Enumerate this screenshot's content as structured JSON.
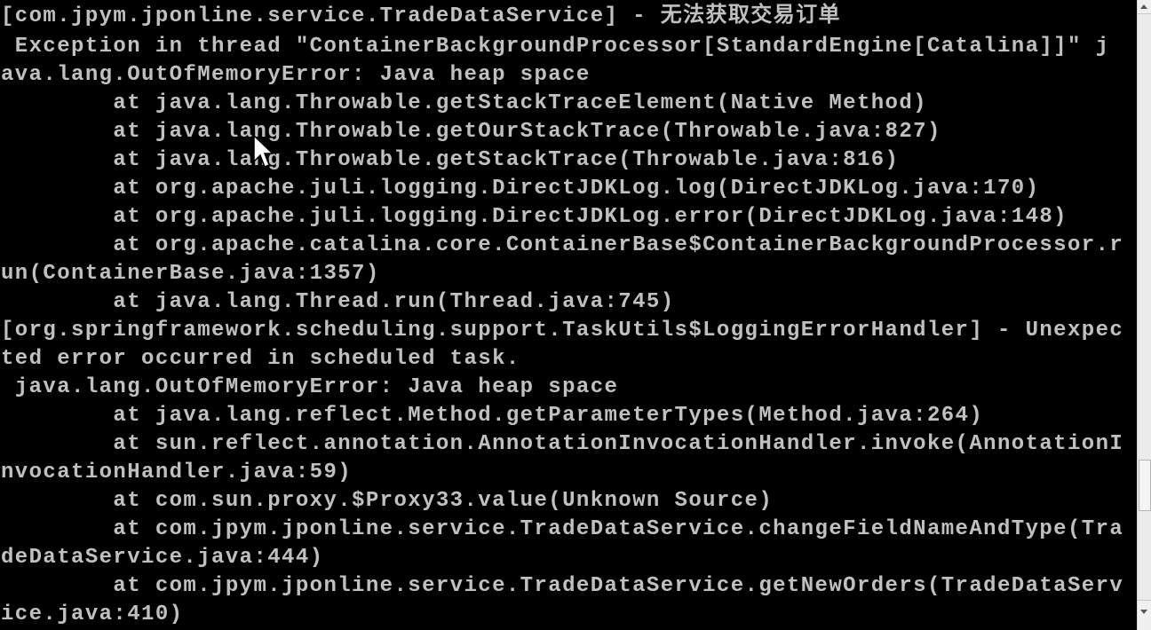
{
  "console": {
    "lines": [
      "[com.jpym.jponline.service.TradeDataService] - 无法获取交易订单",
      " Exception in thread \"ContainerBackgroundProcessor[StandardEngine[Catalina]]\" j",
      "ava.lang.OutOfMemoryError: Java heap space",
      "        at java.lang.Throwable.getStackTraceElement(Native Method)",
      "        at java.lang.Throwable.getOurStackTrace(Throwable.java:827)",
      "        at java.lang.Throwable.getStackTrace(Throwable.java:816)",
      "        at org.apache.juli.logging.DirectJDKLog.log(DirectJDKLog.java:170)",
      "        at org.apache.juli.logging.DirectJDKLog.error(DirectJDKLog.java:148)",
      "        at org.apache.catalina.core.ContainerBase$ContainerBackgroundProcessor.r",
      "un(ContainerBase.java:1357)",
      "        at java.lang.Thread.run(Thread.java:745)",
      "[org.springframework.scheduling.support.TaskUtils$LoggingErrorHandler] - Unexpec",
      "ted error occurred in scheduled task.",
      " java.lang.OutOfMemoryError: Java heap space",
      "        at java.lang.reflect.Method.getParameterTypes(Method.java:264)",
      "        at sun.reflect.annotation.AnnotationInvocationHandler.invoke(AnnotationI",
      "nvocationHandler.java:59)",
      "        at com.sun.proxy.$Proxy33.value(Unknown Source)",
      "        at com.jpym.jponline.service.TradeDataService.changeFieldNameAndType(Tra",
      "deDataService.java:444)",
      "        at com.jpym.jponline.service.TradeDataService.getNewOrders(TradeDataServ",
      "ice.java:410)"
    ]
  },
  "colors": {
    "background": "#000000",
    "text": "#c0c0c0",
    "scrollbar": "#ebebeb"
  },
  "icons": {
    "cursor": "mouse-pointer-icon"
  }
}
